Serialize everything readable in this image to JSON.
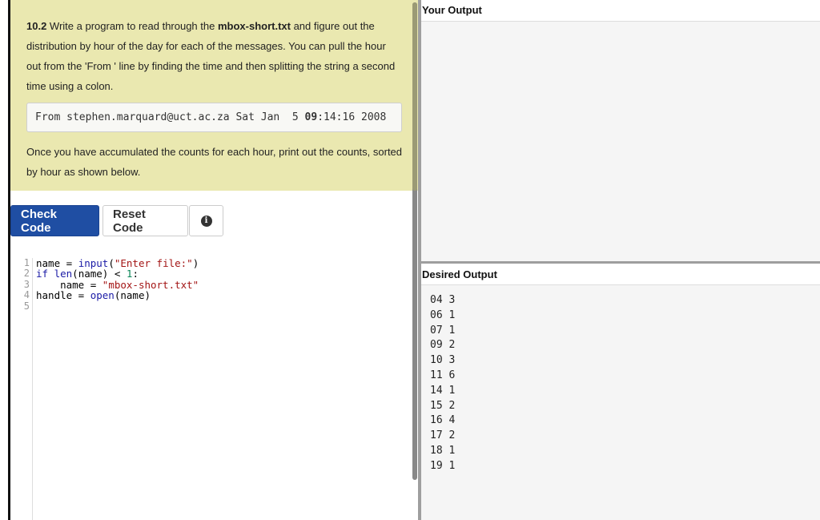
{
  "problem": {
    "number": "10.2",
    "text_1": " Write a program to read through the ",
    "filename": "mbox-short.txt",
    "text_2": " and figure out the distribution by hour of the day for each of the messages. You can pull the hour out from the 'From ' line by finding the time and then splitting the string a second time using a colon.",
    "sample_prefix": "From stephen.marquard@uct.ac.za Sat Jan  5 ",
    "sample_hour": "09",
    "sample_suffix": ":14:16 2008",
    "text_3": "Once you have accumulated the counts for each hour, print out the counts, sorted by hour as shown below."
  },
  "buttons": {
    "check": "Check Code",
    "reset": "Reset Code",
    "info_icon": "info-icon"
  },
  "editor": {
    "line_numbers": [
      "1",
      "2",
      "3",
      "4",
      "5"
    ]
  },
  "output": {
    "your_output_title": "Your Output",
    "desired_output_title": "Desired Output",
    "desired_lines": [
      "04 3",
      "06 1",
      "07 1",
      "09 2",
      "10 3",
      "11 6",
      "14 1",
      "15 2",
      "16 4",
      "17 2",
      "18 1",
      "19 1"
    ]
  },
  "colors": {
    "problem_bg": "#eae8b0",
    "check_button": "#1f4ea3",
    "keyword": "#1a1aa6",
    "string": "#a31515"
  }
}
